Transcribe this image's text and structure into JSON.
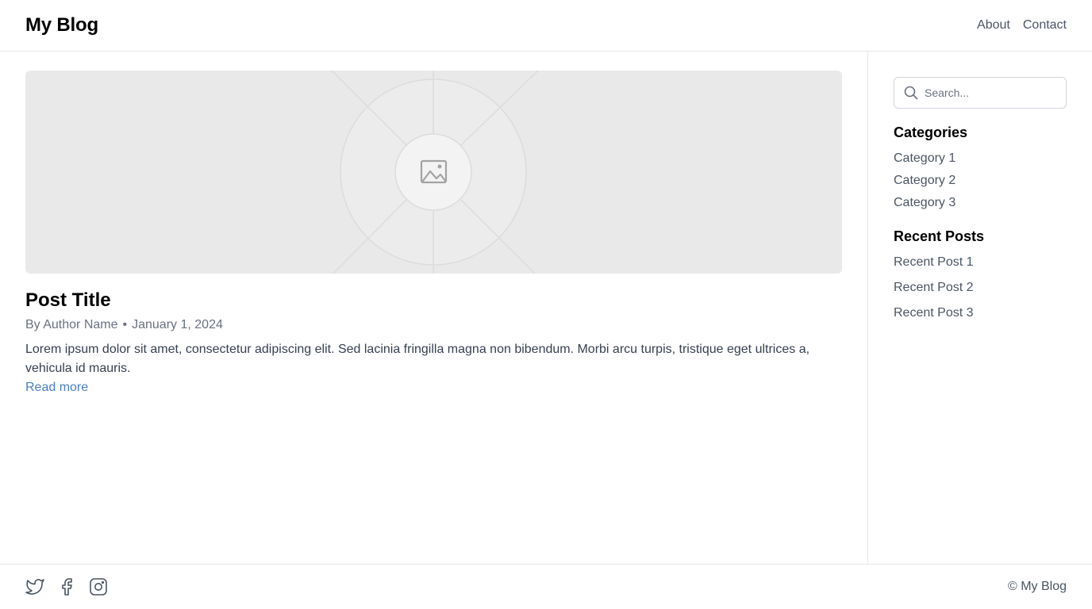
{
  "header": {
    "site_title": "My Blog",
    "nav": [
      {
        "label": "About"
      },
      {
        "label": "Contact"
      }
    ]
  },
  "post": {
    "image_icon": "image-placeholder-icon",
    "title": "Post Title",
    "author": "By Author Name",
    "separator": "•",
    "date": "January 1, 2024",
    "excerpt": "Lorem ipsum dolor sit amet, consectetur adipiscing elit. Sed lacinia fringilla magna non bibendum. Morbi arcu turpis, tristique eget ultrices a, vehicula id mauris.",
    "read_more": "Read more"
  },
  "sidebar": {
    "search": {
      "placeholder": "Search...",
      "icon": "search-icon"
    },
    "categories_heading": "Categories",
    "categories": [
      "Category 1",
      "Category 2",
      "Category 3"
    ],
    "recent_heading": "Recent Posts",
    "recent_posts": [
      "Recent Post 1",
      "Recent Post 2",
      "Recent Post 3"
    ]
  },
  "footer": {
    "social_icons": [
      "twitter-icon",
      "facebook-icon",
      "instagram-icon"
    ],
    "copyright": "© My Blog"
  },
  "colors": {
    "link": "#4a7fc1",
    "text_muted": "#6b7280",
    "border": "#e5e7eb",
    "image_bg": "#e9e9e9"
  }
}
